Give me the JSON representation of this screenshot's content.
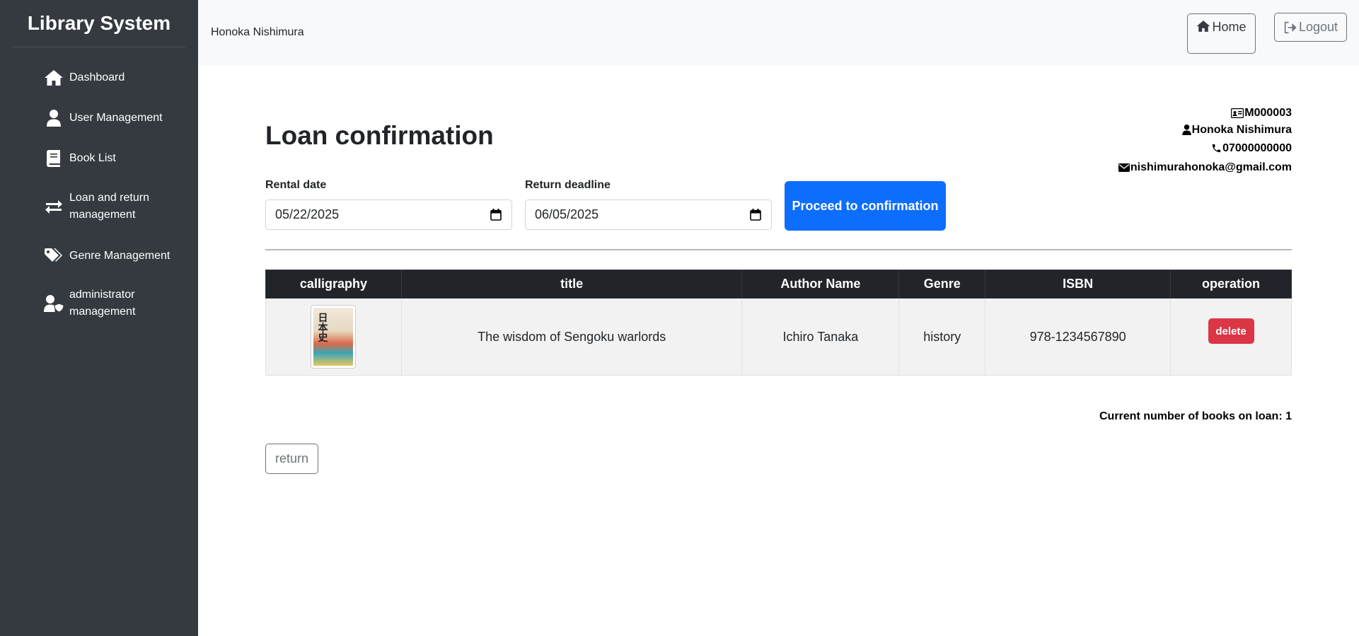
{
  "sidebar": {
    "brand": "Library System",
    "items": [
      {
        "label": "Dashboard",
        "icon": "home-icon"
      },
      {
        "label": "User Management",
        "icon": "user-icon"
      },
      {
        "label": "Book List",
        "icon": "book-icon"
      },
      {
        "label": "Loan and return\nmanagement",
        "icon": "exchange-icon"
      },
      {
        "label": "Genre Management",
        "icon": "tags-icon"
      },
      {
        "label": "administrator\nmanagement",
        "icon": "user-shield-icon"
      }
    ]
  },
  "header": {
    "user_name": "Honoka Nishimura",
    "home_label": "Home",
    "logout_label": "Logout"
  },
  "main": {
    "title": "Loan confirmation",
    "member": {
      "id": "M000003",
      "name": "Honoka Nishimura",
      "phone": "07000000000",
      "email": "nishimurahonoka@gmail.com"
    },
    "rental_date_label": "Rental date",
    "rental_date_value": "05/22/2025",
    "return_deadline_label": "Return deadline",
    "return_deadline_value": "06/05/2025",
    "proceed_label": "Proceed to confirmation",
    "table": {
      "headers": [
        "calligraphy",
        "title",
        "Author Name",
        "Genre",
        "ISBN",
        "operation"
      ],
      "rows": [
        {
          "title": "The wisdom of Sengoku warlords",
          "author": "Ichiro Tanaka",
          "genre": "history",
          "isbn": "978-1234567890",
          "action": "delete"
        }
      ]
    },
    "loan_count_text": "Current number of books on loan: 1",
    "return_label": "return"
  },
  "colors": {
    "sidebar_bg": "#343a40",
    "primary": "#0d6efd",
    "danger": "#dc3545",
    "table_header_bg": "#212529"
  }
}
